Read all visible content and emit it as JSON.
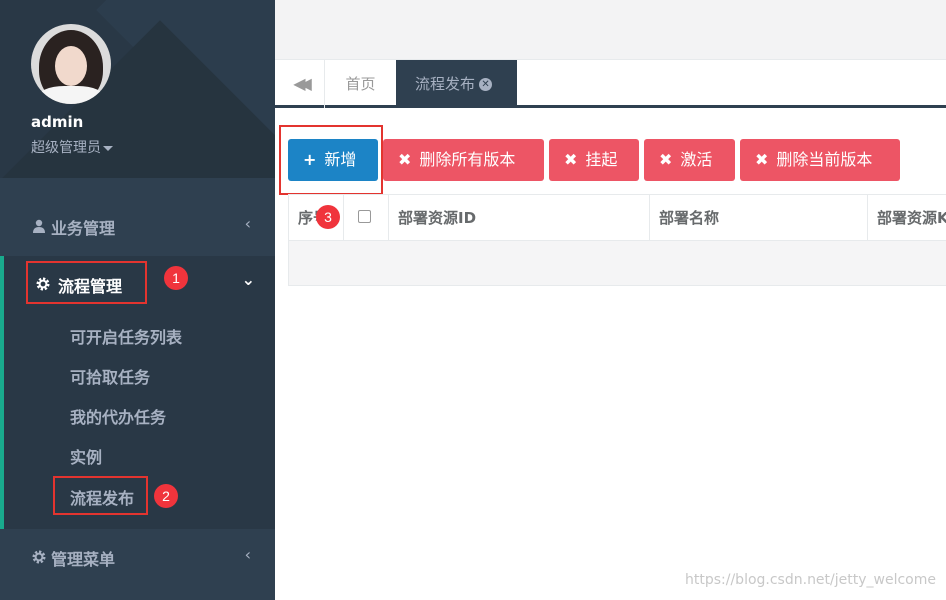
{
  "profile": {
    "name": "admin",
    "role": "超级管理员"
  },
  "nav": {
    "business": {
      "label": "业务管理",
      "icon": "user-icon"
    },
    "process": {
      "label": "流程管理",
      "icon": "gear-icon",
      "items": [
        "可开启任务列表",
        "可拾取任务",
        "我的代办任务",
        "实例",
        "流程发布"
      ]
    },
    "admin_menu": {
      "label": "管理菜单",
      "icon": "gear-icon"
    }
  },
  "annotations": [
    "1",
    "2",
    "3"
  ],
  "tabs": {
    "home": "首页",
    "current": "流程发布"
  },
  "toolbar": {
    "add": "新增",
    "delete_all": "删除所有版本",
    "suspend": "挂起",
    "activate": "激活",
    "delete_current": "删除当前版本"
  },
  "table": {
    "columns": [
      "序号",
      "",
      "部署资源ID",
      "部署名称",
      "部署资源KEY"
    ]
  },
  "watermark": "https://blog.csdn.net/jetty_welcome",
  "colors": {
    "sidebar": "#2f4050",
    "active_border": "#19aa8d",
    "primary": "#1c84c6",
    "danger": "#ed5565",
    "annotation": "#e3342f"
  }
}
